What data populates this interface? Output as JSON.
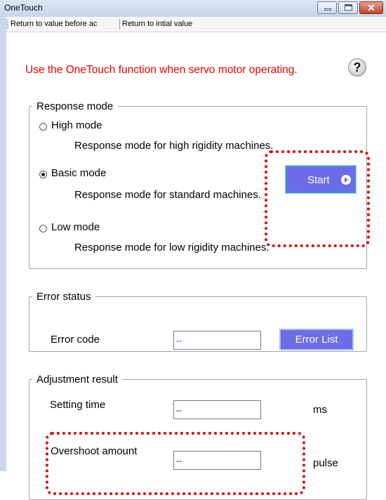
{
  "window": {
    "title": "OneTouch"
  },
  "toolbar": {
    "return_before": "Return to value before ac",
    "return_initial": "Return to intial value"
  },
  "notice": "Use the OneTouch function when servo motor operating.",
  "icons": {
    "help": "help-question-icon"
  },
  "response_mode": {
    "legend": "Response mode",
    "options": [
      {
        "label": "High mode",
        "description": "Response mode for high rigidity machines.",
        "checked": false
      },
      {
        "label": "Basic mode",
        "description": "Response mode for standard machines.",
        "checked": true
      },
      {
        "label": "Low mode",
        "description": "Response mode for low rigidity machines.",
        "checked": false
      }
    ],
    "start_label": "Start"
  },
  "error_status": {
    "legend": "Error status",
    "code_label": "Error code",
    "code_value": "--",
    "list_button": "Error List"
  },
  "adjustment": {
    "legend": "Adjustment result",
    "setting_time_label": "Setting time",
    "setting_time_value": "--",
    "setting_time_unit": "ms",
    "overshoot_label": "Overshoot amount",
    "overshoot_value": "--",
    "overshoot_unit": "pulse"
  },
  "colors": {
    "notice": "#e60000",
    "button": "#6a6ce8",
    "highlight": "#e00000"
  }
}
